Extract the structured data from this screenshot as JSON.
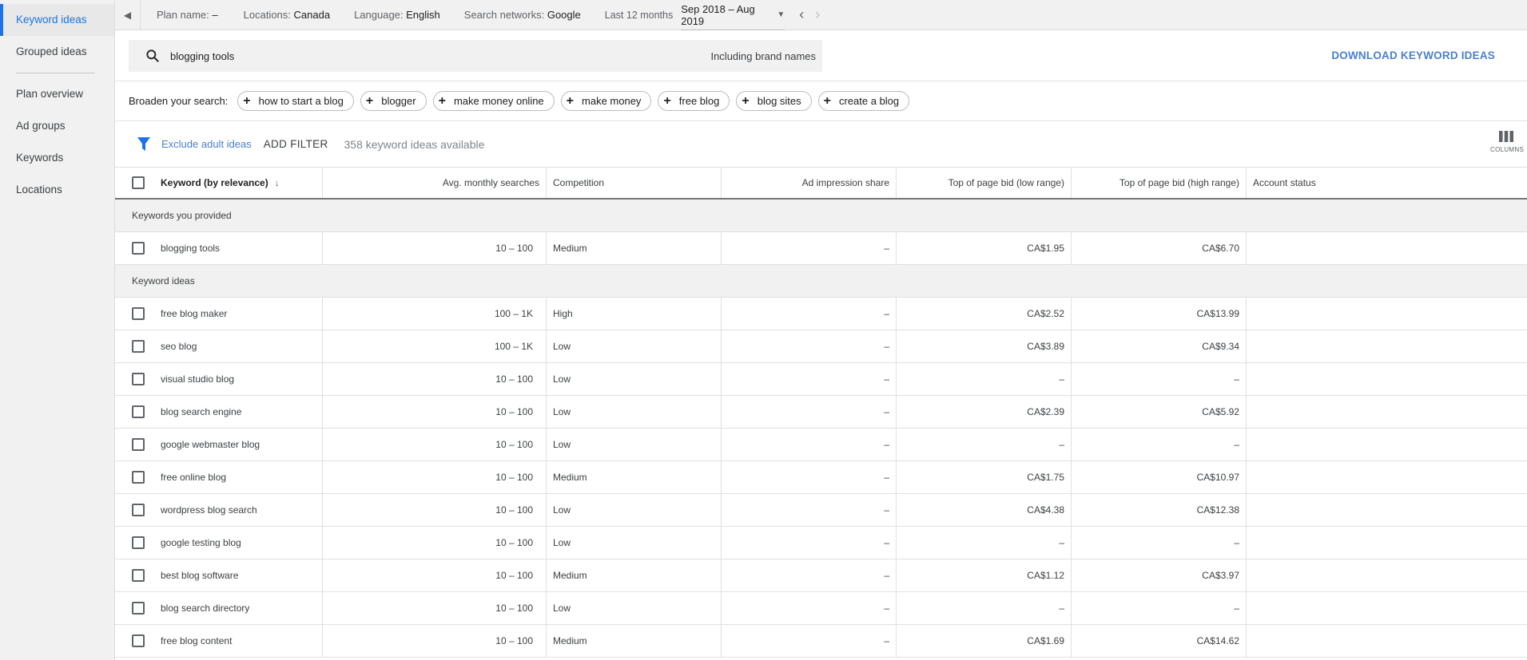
{
  "sidebar": {
    "items": [
      {
        "label": "Keyword ideas",
        "active": true
      },
      {
        "label": "Grouped ideas"
      },
      {
        "label": "Plan overview"
      },
      {
        "label": "Ad groups"
      },
      {
        "label": "Keywords"
      },
      {
        "label": "Locations"
      }
    ]
  },
  "topbar": {
    "plan_label": "Plan name:",
    "plan_value": "–",
    "locations_label": "Locations:",
    "locations_value": "Canada",
    "language_label": "Language:",
    "language_value": "English",
    "networks_label": "Search networks:",
    "networks_value": "Google",
    "period_label": "Last 12 months",
    "period_value": "Sep 2018 – Aug 2019"
  },
  "search": {
    "query": "blogging tools",
    "brand_names": "Including brand names",
    "download_label": "DOWNLOAD KEYWORD IDEAS"
  },
  "broaden": {
    "label": "Broaden your search:",
    "chips": [
      "how to start a blog",
      "blogger",
      "make money online",
      "make money",
      "free blog",
      "blog sites",
      "create a blog"
    ]
  },
  "filters": {
    "exclude_label": "Exclude adult ideas",
    "add_filter_label": "ADD FILTER",
    "available_text": "358 keyword ideas available",
    "columns_label": "COLUMNS"
  },
  "table": {
    "headers": {
      "keyword": "Keyword (by relevance)",
      "avg": "Avg. monthly searches",
      "competition": "Competition",
      "impression": "Ad impression share",
      "bid_low": "Top of page bid (low range)",
      "bid_high": "Top of page bid (high range)",
      "account": "Account status"
    },
    "section_provided": "Keywords you provided",
    "section_ideas": "Keyword ideas",
    "provided_rows": [
      {
        "keyword": "blogging tools",
        "avg": "10 – 100",
        "competition": "Medium",
        "impression": "–",
        "bid_low": "CA$1.95",
        "bid_high": "CA$6.70",
        "account": ""
      }
    ],
    "idea_rows": [
      {
        "keyword": "free blog maker",
        "avg": "100 – 1K",
        "competition": "High",
        "impression": "–",
        "bid_low": "CA$2.52",
        "bid_high": "CA$13.99",
        "account": ""
      },
      {
        "keyword": "seo blog",
        "avg": "100 – 1K",
        "competition": "Low",
        "impression": "–",
        "bid_low": "CA$3.89",
        "bid_high": "CA$9.34",
        "account": ""
      },
      {
        "keyword": "visual studio blog",
        "avg": "10 – 100",
        "competition": "Low",
        "impression": "–",
        "bid_low": "–",
        "bid_high": "–",
        "account": ""
      },
      {
        "keyword": "blog search engine",
        "avg": "10 – 100",
        "competition": "Low",
        "impression": "–",
        "bid_low": "CA$2.39",
        "bid_high": "CA$5.92",
        "account": ""
      },
      {
        "keyword": "google webmaster blog",
        "avg": "10 – 100",
        "competition": "Low",
        "impression": "–",
        "bid_low": "–",
        "bid_high": "–",
        "account": ""
      },
      {
        "keyword": "free online blog",
        "avg": "10 – 100",
        "competition": "Medium",
        "impression": "–",
        "bid_low": "CA$1.75",
        "bid_high": "CA$10.97",
        "account": ""
      },
      {
        "keyword": "wordpress blog search",
        "avg": "10 – 100",
        "competition": "Low",
        "impression": "–",
        "bid_low": "CA$4.38",
        "bid_high": "CA$12.38",
        "account": ""
      },
      {
        "keyword": "google testing blog",
        "avg": "10 – 100",
        "competition": "Low",
        "impression": "–",
        "bid_low": "–",
        "bid_high": "–",
        "account": ""
      },
      {
        "keyword": "best blog software",
        "avg": "10 – 100",
        "competition": "Medium",
        "impression": "–",
        "bid_low": "CA$1.12",
        "bid_high": "CA$3.97",
        "account": ""
      },
      {
        "keyword": "blog search directory",
        "avg": "10 – 100",
        "competition": "Low",
        "impression": "–",
        "bid_low": "–",
        "bid_high": "–",
        "account": ""
      },
      {
        "keyword": "free blog content",
        "avg": "10 – 100",
        "competition": "Medium",
        "impression": "–",
        "bid_low": "CA$1.69",
        "bid_high": "CA$14.62",
        "account": ""
      }
    ]
  },
  "colors": {
    "accent": "#1a73e8",
    "link": "#4a7fd0",
    "sidebar_bg": "#f1f1f1"
  },
  "icons": {
    "search": "search-icon",
    "filter": "filter-icon",
    "columns": "columns-icon",
    "collapse": "collapse-left-icon",
    "prev": "chevron-left-icon",
    "next": "chevron-right-icon",
    "caret": "caret-down-icon",
    "plus": "plus-icon",
    "sort": "arrow-down-icon"
  }
}
